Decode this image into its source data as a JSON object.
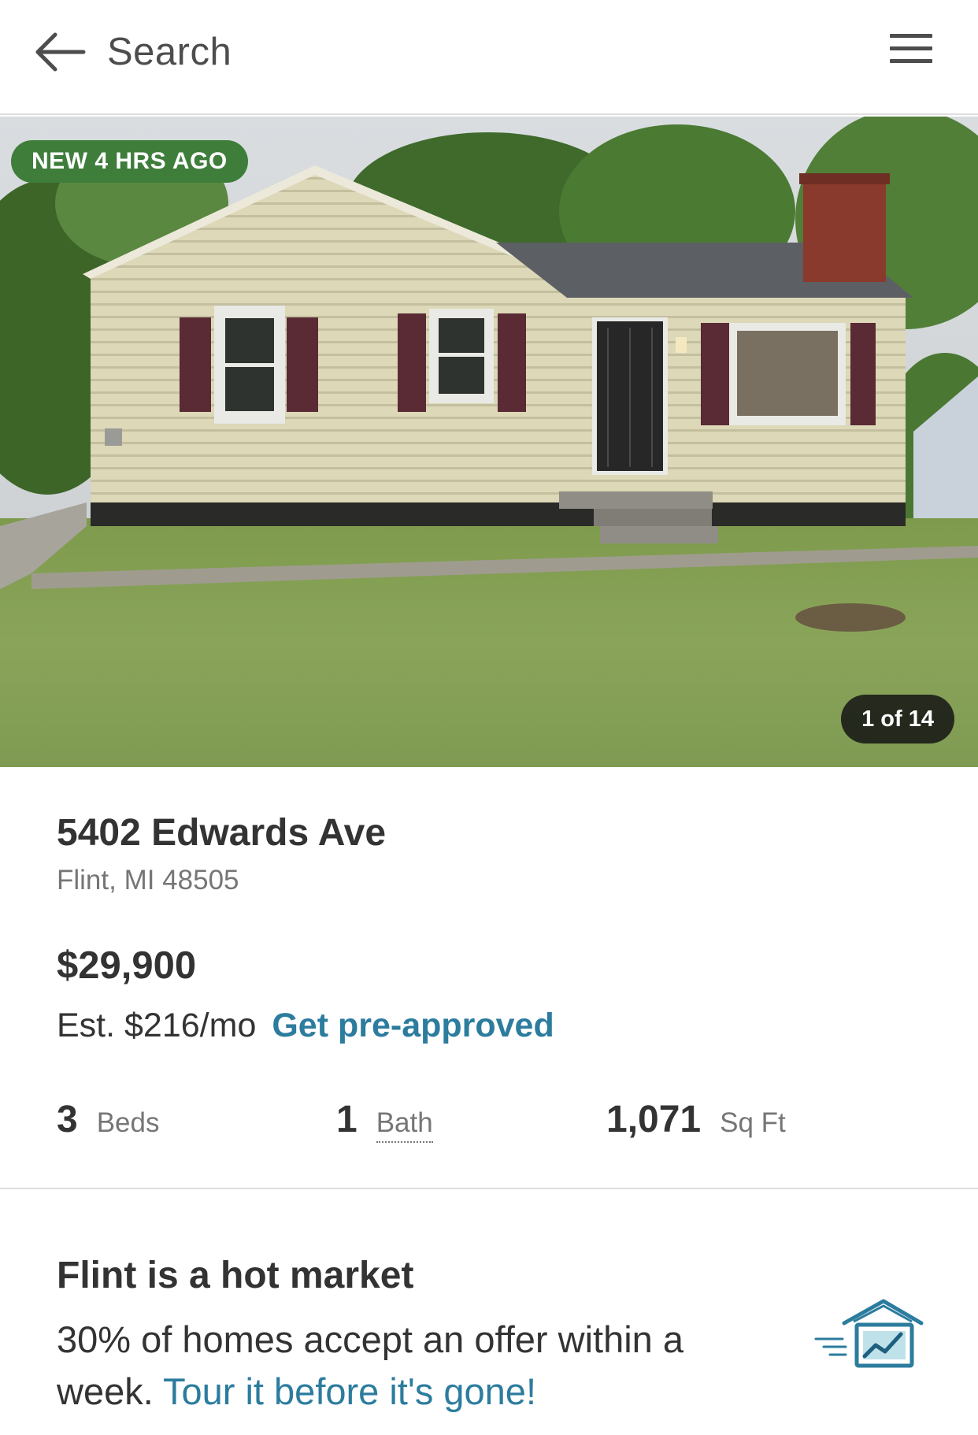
{
  "header": {
    "back_label": "Search",
    "back_icon": "arrow-left-icon",
    "menu_icon": "hamburger-menu-icon"
  },
  "photo": {
    "badge": "NEW 4 HRS AGO",
    "counter": "1 of 14",
    "badge_color": "#3f7d3b"
  },
  "listing": {
    "address": "5402 Edwards Ave",
    "city": "Flint, MI 48505",
    "price": "$29,900",
    "est_payment": "Est. $216/mo",
    "preapproved_link": "Get pre-approved",
    "beds_value": "3",
    "beds_label": "Beds",
    "baths_value": "1",
    "baths_label": "Bath",
    "sqft_value": "1,071",
    "sqft_label": "Sq Ft"
  },
  "market": {
    "title": "Flint is a hot market",
    "body": "30% of homes accept an offer within a week.",
    "link": " Tour it before it's gone!",
    "icon": "house-trend-icon"
  },
  "colors": {
    "link": "#2c7c9e",
    "text": "#333333",
    "muted": "#767676"
  }
}
